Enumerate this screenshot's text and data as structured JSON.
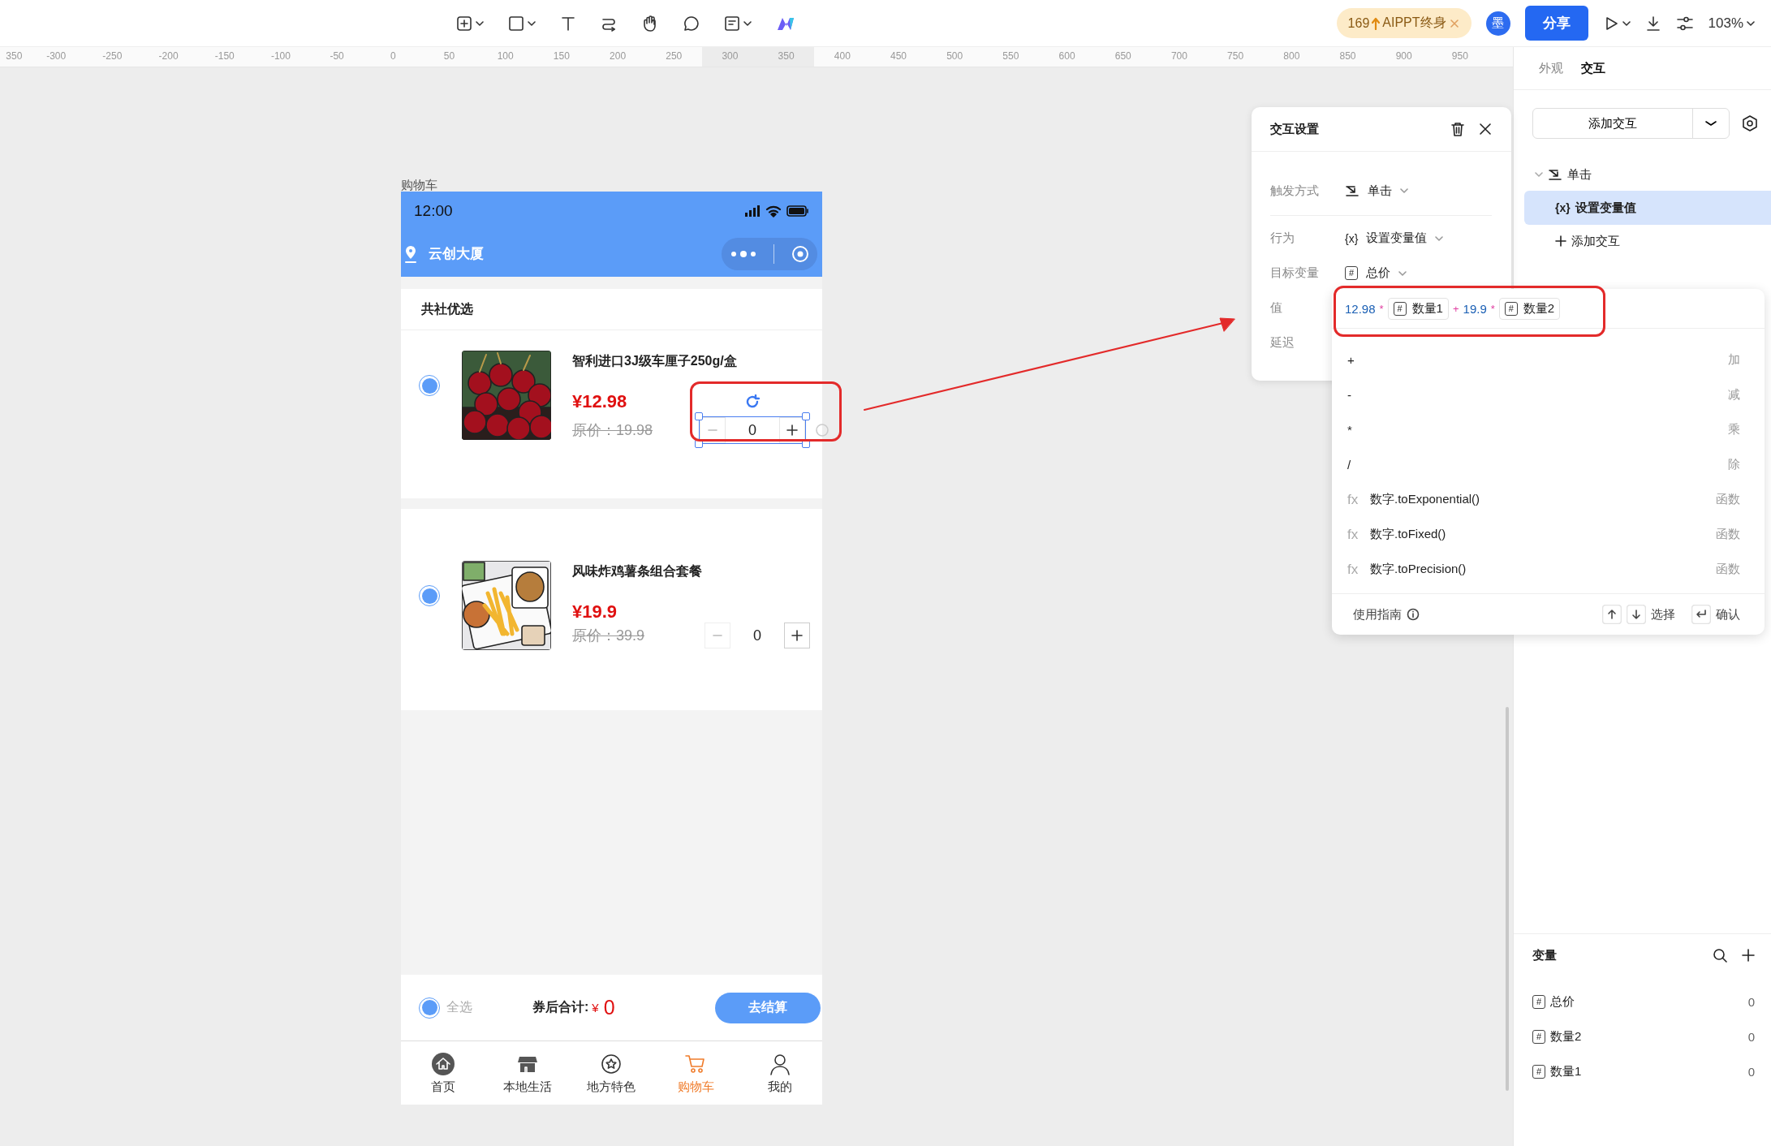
{
  "toolbar": {
    "promo": {
      "count": "169",
      "label": "AIPPT终身"
    },
    "avatar": "墨",
    "share": "分享",
    "zoom": "103%"
  },
  "ruler": {
    "labels": [
      {
        "text": "350",
        "highlighted": false
      },
      {
        "text": "-300",
        "highlighted": false
      },
      {
        "text": "-250",
        "highlighted": false
      },
      {
        "text": "-200",
        "highlighted": false
      },
      {
        "text": "-150",
        "highlighted": false
      },
      {
        "text": "-100",
        "highlighted": false
      },
      {
        "text": "-50",
        "highlighted": false
      },
      {
        "text": "0",
        "highlighted": false
      },
      {
        "text": "50",
        "highlighted": false
      },
      {
        "text": "100",
        "highlighted": false
      },
      {
        "text": "150",
        "highlighted": false
      },
      {
        "text": "200",
        "highlighted": false
      },
      {
        "text": "250",
        "highlighted": false
      },
      {
        "text": "300",
        "highlighted": true
      },
      {
        "text": "350",
        "highlighted": true
      },
      {
        "text": "400",
        "highlighted": false
      },
      {
        "text": "450",
        "highlighted": false
      },
      {
        "text": "500",
        "highlighted": false
      },
      {
        "text": "550",
        "highlighted": false
      },
      {
        "text": "600",
        "highlighted": false
      },
      {
        "text": "650",
        "highlighted": false
      },
      {
        "text": "700",
        "highlighted": false
      },
      {
        "text": "750",
        "highlighted": false
      },
      {
        "text": "800",
        "highlighted": false
      },
      {
        "text": "850",
        "highlighted": false
      },
      {
        "text": "900",
        "highlighted": false
      },
      {
        "text": "950",
        "highlighted": false
      }
    ]
  },
  "phone": {
    "frame_label": "购物车",
    "time": "12:00",
    "location": "云创大厦",
    "section_title": "共社优选",
    "products": [
      {
        "name": "智利进口3J级车厘子250g/盒",
        "price": "¥12.98",
        "original_price": "原价：19.98",
        "quantity": "0",
        "checked": true,
        "selected": true
      },
      {
        "name": "风味炸鸡薯条组合套餐",
        "price": "¥19.9",
        "original_price": "原价：39.9",
        "quantity": "0",
        "checked": true,
        "selected": false
      }
    ],
    "select_all": {
      "label": "全选",
      "checked": true
    },
    "total": {
      "label": "券后合计:",
      "currency": "¥",
      "amount": "0"
    },
    "checkout": "去结算",
    "tabs": [
      {
        "label": "首页",
        "selected": false
      },
      {
        "label": "本地生活",
        "selected": false
      },
      {
        "label": "地方特色",
        "selected": false
      },
      {
        "label": "购物车",
        "selected": true
      },
      {
        "label": "我的",
        "selected": false
      }
    ]
  },
  "interaction_panel": {
    "title": "交互设置",
    "fields": [
      {
        "label": "触发方式",
        "kind": "trigger",
        "value": "单击"
      },
      {
        "label": "行为",
        "kind": "icon",
        "icon_text": "{x}",
        "value": "设置变量值"
      },
      {
        "label": "目标变量",
        "kind": "boxed",
        "icon_text": "#",
        "value": "总价"
      },
      {
        "label": "值",
        "kind": "plain"
      },
      {
        "label": "延迟",
        "kind": "plain"
      }
    ]
  },
  "expression_popup": {
    "tokens": [
      {
        "kind": "number",
        "text": "12.98"
      },
      {
        "kind": "operator",
        "text": "*"
      },
      {
        "kind": "variable",
        "icon_text": "#",
        "text": "数量1"
      },
      {
        "kind": "operator",
        "text": "+"
      },
      {
        "kind": "number",
        "text": "19.9"
      },
      {
        "kind": "operator",
        "text": "*"
      },
      {
        "kind": "variable",
        "icon_text": "#",
        "text": "数量2"
      }
    ],
    "options": [
      {
        "kind": "operator",
        "symbol": "+",
        "description": "加"
      },
      {
        "kind": "operator",
        "symbol": "-",
        "description": "减"
      },
      {
        "kind": "operator",
        "symbol": "*",
        "description": "乘"
      },
      {
        "kind": "operator",
        "symbol": "/",
        "description": "除"
      },
      {
        "kind": "function",
        "prefix": "fx",
        "symbol": "数字.toExponential()",
        "description": "函数"
      },
      {
        "kind": "function",
        "prefix": "fx",
        "symbol": "数字.toFixed()",
        "description": "函数"
      },
      {
        "kind": "function",
        "prefix": "fx",
        "symbol": "数字.toPrecision()",
        "description": "函数"
      }
    ],
    "footer": {
      "guide": "使用指南",
      "select": "选择",
      "confirm": "确认"
    }
  },
  "sidebar": {
    "tabs": [
      {
        "label": "外观",
        "selected": false
      },
      {
        "label": "交互",
        "selected": true
      }
    ],
    "add_button": "添加交互",
    "tree": [
      {
        "label": "单击",
        "expanded": true,
        "children": [
          {
            "icon_text": "{x}",
            "label": "设置变量值",
            "selected": true
          }
        ]
      }
    ],
    "add_link": "添加交互",
    "variables": {
      "title": "变量",
      "items": [
        {
          "icon_text": "#",
          "name": "总价",
          "value": "0"
        },
        {
          "icon_text": "#",
          "name": "数量2",
          "value": "0"
        },
        {
          "icon_text": "#",
          "name": "数量1",
          "value": "0"
        }
      ]
    }
  }
}
